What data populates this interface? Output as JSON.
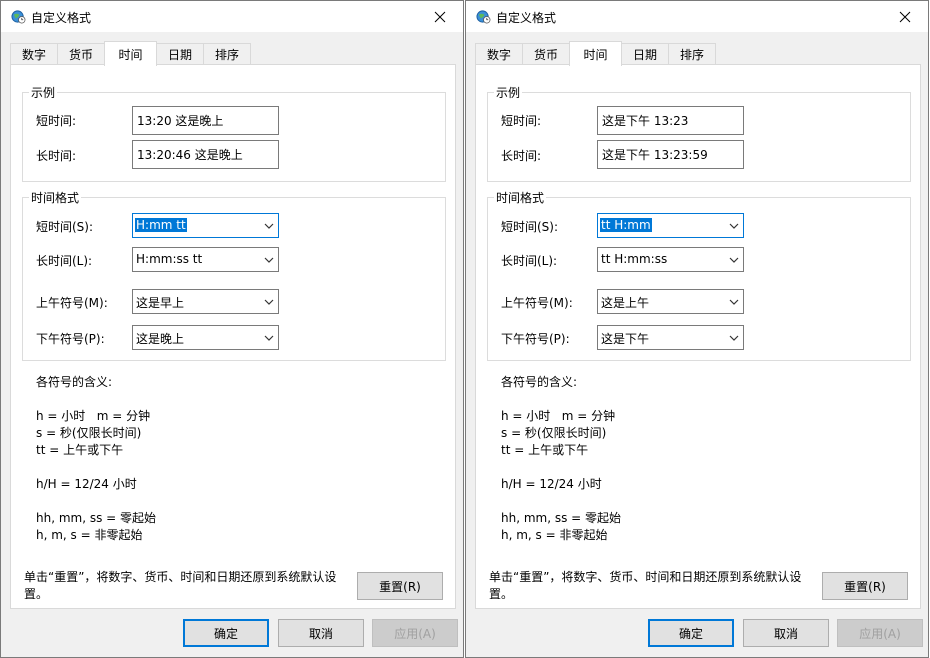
{
  "dialogs": [
    {
      "title": "自定义格式",
      "tabs": [
        "数字",
        "货币",
        "时间",
        "日期",
        "排序"
      ],
      "active_tab": "时间",
      "sample_group": "示例",
      "short_time_label": "短时间:",
      "short_time_sample": "13:20 这是晚上",
      "long_time_label": "长时间:",
      "long_time_sample": "13:20:46 这是晚上",
      "format_group": "时间格式",
      "short_time_format_label": "短时间(S):",
      "short_time_format": "H:mm tt",
      "long_time_format_label": "长时间(L):",
      "long_time_format": "H:mm:ss tt",
      "am_label": "上午符号(M):",
      "am_symbol": "这是早上",
      "pm_label": "下午符号(P):",
      "pm_symbol": "这是晚上",
      "legend": [
        "各符号的含义:",
        "",
        "h = 小时   m = 分钟",
        "s = 秒(仅限长时间)",
        "tt = 上午或下午",
        "",
        "h/H = 12/24 小时",
        "",
        "hh, mm, ss = 零起始",
        "h, m, s = 非零起始"
      ],
      "reset_note": "单击“重置”，将数字、货币、时间和日期还原到系统默认设置。",
      "reset_button": "重置(R)",
      "ok_button": "确定",
      "cancel_button": "取消",
      "apply_button": "应用(A)"
    },
    {
      "title": "自定义格式",
      "tabs": [
        "数字",
        "货币",
        "时间",
        "日期",
        "排序"
      ],
      "active_tab": "时间",
      "sample_group": "示例",
      "short_time_label": "短时间:",
      "short_time_sample": "这是下午 13:23",
      "long_time_label": "长时间:",
      "long_time_sample": "这是下午 13:23:59",
      "format_group": "时间格式",
      "short_time_format_label": "短时间(S):",
      "short_time_format": "tt H:mm",
      "long_time_format_label": "长时间(L):",
      "long_time_format": "tt H:mm:ss",
      "am_label": "上午符号(M):",
      "am_symbol": "这是上午",
      "pm_label": "下午符号(P):",
      "pm_symbol": "这是下午",
      "legend": [
        "各符号的含义:",
        "",
        "h = 小时   m = 分钟",
        "s = 秒(仅限长时间)",
        "tt = 上午或下午",
        "",
        "h/H = 12/24 小时",
        "",
        "hh, mm, ss = 零起始",
        "h, m, s = 非零起始"
      ],
      "reset_note": "单击“重置”，将数字、货币、时间和日期还原到系统默认设置。",
      "reset_button": "重置(R)",
      "ok_button": "确定",
      "cancel_button": "取消",
      "apply_button": "应用(A)"
    }
  ],
  "icons": {
    "app": "globe-clock-icon",
    "close": "close-icon",
    "dropdown": "chevron-down-icon"
  },
  "colors": {
    "accent": "#0078d7",
    "dialog_bg": "#f0f0f0",
    "panel_bg": "#ffffff",
    "disabled_text": "#a0a0a0"
  }
}
